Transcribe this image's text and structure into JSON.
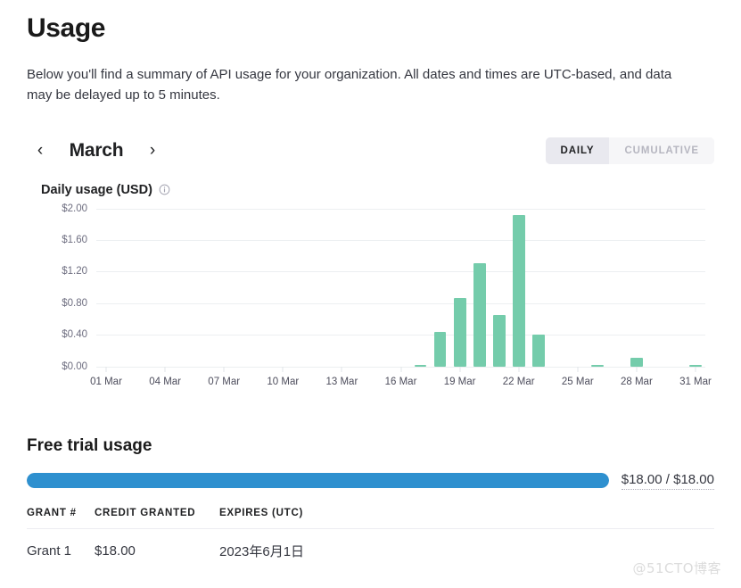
{
  "header": {
    "title": "Usage",
    "intro": "Below you'll find a summary of API usage for your organization. All dates and times are UTC-based, and data may be delayed up to 5 minutes."
  },
  "controls": {
    "prev_arrow": "‹",
    "next_arrow": "›",
    "month": "March",
    "toggle": {
      "daily": "DAILY",
      "cumulative": "CUMULATIVE",
      "selected": "DAILY"
    }
  },
  "chart_data": {
    "type": "bar",
    "title": "Daily usage (USD)",
    "xlabel": "",
    "ylabel": "",
    "ylim": [
      0,
      2.0
    ],
    "grid": true,
    "legend": "none",
    "ytick_labels": [
      "$2.00",
      "$1.60",
      "$1.20",
      "$0.80",
      "$0.40",
      "$0.00"
    ],
    "ytick_values": [
      2.0,
      1.6,
      1.2,
      0.8,
      0.4,
      0.0
    ],
    "categories": [
      "01 Mar",
      "02 Mar",
      "03 Mar",
      "04 Mar",
      "05 Mar",
      "06 Mar",
      "07 Mar",
      "08 Mar",
      "09 Mar",
      "10 Mar",
      "11 Mar",
      "12 Mar",
      "13 Mar",
      "14 Mar",
      "15 Mar",
      "16 Mar",
      "17 Mar",
      "18 Mar",
      "19 Mar",
      "20 Mar",
      "21 Mar",
      "22 Mar",
      "23 Mar",
      "24 Mar",
      "25 Mar",
      "26 Mar",
      "27 Mar",
      "28 Mar",
      "29 Mar",
      "30 Mar",
      "31 Mar"
    ],
    "xtick_labels": [
      "01 Mar",
      "04 Mar",
      "07 Mar",
      "10 Mar",
      "13 Mar",
      "16 Mar",
      "19 Mar",
      "22 Mar",
      "25 Mar",
      "28 Mar",
      "31 Mar"
    ],
    "xtick_indices": [
      0,
      3,
      6,
      9,
      12,
      15,
      18,
      21,
      24,
      27,
      30
    ],
    "values": [
      0,
      0,
      0,
      0,
      0,
      0,
      0,
      0,
      0,
      0,
      0,
      0,
      0,
      0,
      0,
      0,
      0.02,
      0.43,
      0.87,
      1.31,
      0.65,
      1.92,
      0.4,
      0,
      0,
      0.01,
      0,
      0.11,
      0,
      0,
      0.01
    ],
    "bar_color": "#74ccab"
  },
  "free_trial": {
    "section_title": "Free trial usage",
    "progress_label": "$18.00 / $18.00",
    "progress_percent": 100,
    "progress_color": "#2e90cf",
    "table": {
      "columns": [
        "GRANT #",
        "CREDIT GRANTED",
        "EXPIRES (UTC)"
      ],
      "rows": [
        [
          "Grant 1",
          "$18.00",
          "2023年6月1日"
        ]
      ]
    }
  },
  "watermark": "@51CTO博客"
}
